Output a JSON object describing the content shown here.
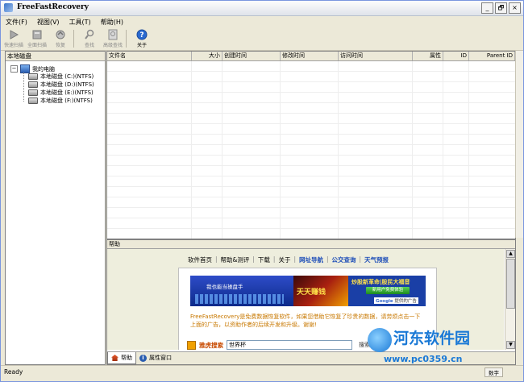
{
  "window": {
    "title": "FreeFastRecovery",
    "controls": [
      "_",
      "🗗",
      "×"
    ]
  },
  "menu": [
    "文件(F)",
    "视图(V)",
    "工具(T)",
    "帮助(H)"
  ],
  "toolbar": {
    "buttons": [
      {
        "label": "快速扫描",
        "icon": "scan-fast-icon",
        "enabled": false
      },
      {
        "label": "全面扫描",
        "icon": "scan-full-icon",
        "enabled": false
      },
      {
        "label": "恢复",
        "icon": "recover-icon",
        "enabled": false
      },
      {
        "label": "查找",
        "icon": "find-icon",
        "enabled": false
      },
      {
        "label": "高级查找",
        "icon": "advanced-find-icon",
        "enabled": false
      },
      {
        "label": "关于",
        "icon": "help-icon",
        "enabled": true
      }
    ]
  },
  "left_pane": {
    "header": "本地磁盘",
    "root": "我的电脑",
    "drives": [
      "本地磁盘 (C:)(NTFS)",
      "本地磁盘 (D:)(NTFS)",
      "本地磁盘 (E:)(NTFS)",
      "本地磁盘 (F:)(NTFS)"
    ]
  },
  "file_list": {
    "columns": [
      "文件名",
      "大小",
      "创建时间",
      "修改时间",
      "访问时间",
      "属性",
      "ID",
      "Parent ID"
    ]
  },
  "help_pane": {
    "header": "帮助",
    "nav": [
      "软件首页",
      "帮助&测评",
      "下载",
      "关于",
      "网址导航",
      "公交查询",
      "天气预报"
    ],
    "banner": {
      "left_text": "我也能当操盘手",
      "mid_text": "天天赚钱",
      "right_text": "炒股新革命|股民大福音",
      "cta": "新用户免费体验",
      "ad_brand": "Google",
      "ad_note": "提供的广告"
    },
    "paragraph": "FreeFastRecovery是免费数据恢复软件，如果您借助它恢复了珍贵的数据，请劳烦点击一下上面的广告，以资助作者的后续开发和升级。谢谢!",
    "search": {
      "brand": "雅虎搜索",
      "value": "世界杯",
      "button": "搜索"
    },
    "tabs": [
      "帮助",
      "属性窗口"
    ]
  },
  "statusbar": {
    "text": "Ready",
    "right": "数字"
  },
  "watermark": {
    "title": "河东软件园",
    "url": "www.pc0359.cn"
  },
  "colors": {
    "window_bg": "#ece9d8",
    "accent_blue": "#1f4fb8",
    "watermark_blue": "#1a79d6",
    "help_text_orange": "#c87800"
  }
}
